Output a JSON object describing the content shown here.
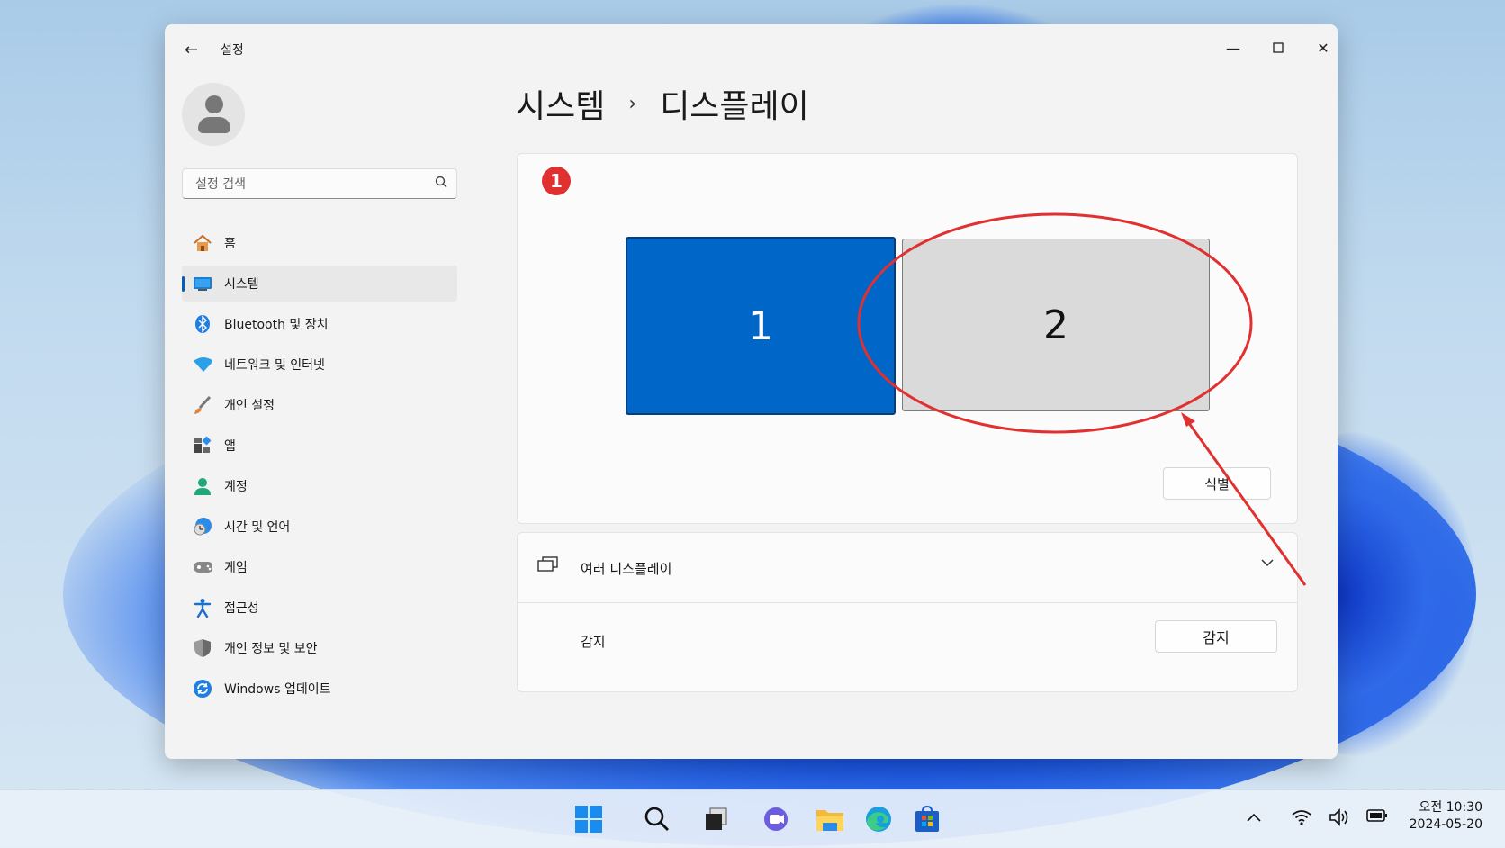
{
  "window": {
    "title": "설정",
    "back_icon": "arrow-left-icon"
  },
  "search": {
    "placeholder": "설정 검색"
  },
  "nav": {
    "items": [
      {
        "label": "홈",
        "icon": "home-icon"
      },
      {
        "label": "시스템",
        "icon": "system-icon",
        "active": true
      },
      {
        "label": "Bluetooth 및 장치",
        "icon": "bluetooth-icon"
      },
      {
        "label": "네트워크 및 인터넷",
        "icon": "wifi-icon"
      },
      {
        "label": "개인 설정",
        "icon": "brush-icon"
      },
      {
        "label": "앱",
        "icon": "apps-icon"
      },
      {
        "label": "계정",
        "icon": "account-icon"
      },
      {
        "label": "시간 및 언어",
        "icon": "globe-clock-icon"
      },
      {
        "label": "게임",
        "icon": "gamepad-icon"
      },
      {
        "label": "접근성",
        "icon": "accessibility-icon"
      },
      {
        "label": "개인 정보 및 보안",
        "icon": "shield-icon"
      },
      {
        "label": "Windows 업데이트",
        "icon": "update-icon"
      }
    ]
  },
  "breadcrumb": {
    "parent": "시스템",
    "separator": "›",
    "current": "디스플레이"
  },
  "display_arrangement": {
    "step_badge": "1",
    "monitor_1": "1",
    "monitor_2": "2",
    "identify_button": "식별"
  },
  "multiple_displays": {
    "label": "여러 디스플레이",
    "detect_label": "감지",
    "detect_button": "감지"
  },
  "taskbar": {
    "clock_time": "오전 10:30",
    "clock_date": "2024-05-20"
  },
  "colors": {
    "accent": "#005fb8",
    "monitor_selected": "#0067c9",
    "annotation_red": "#e13030"
  }
}
